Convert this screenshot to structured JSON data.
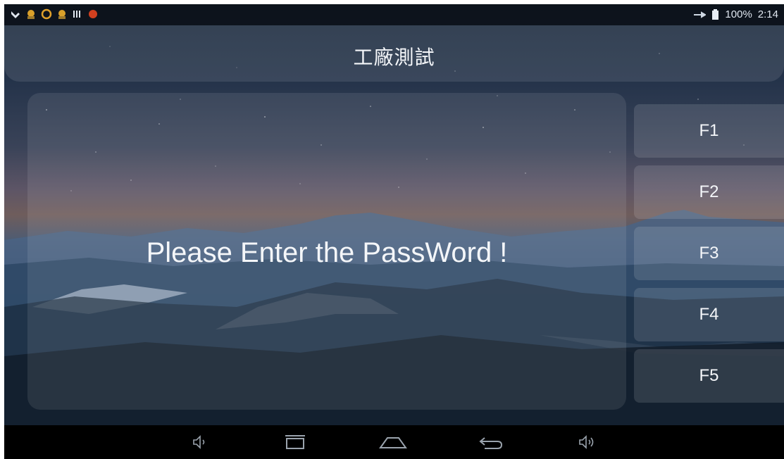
{
  "status_bar": {
    "left_icons": [
      "tool-icon",
      "android-icon",
      "sync-icon",
      "android-icon",
      "barcode-icon",
      "record-icon"
    ],
    "battery": "100%",
    "time": "2:14"
  },
  "header": {
    "title": "工廠測試"
  },
  "main": {
    "message": "Please Enter the PassWord !"
  },
  "function_buttons": [
    "F1",
    "F2",
    "F3",
    "F4",
    "F5"
  ],
  "nav_bar": {
    "icons": [
      "volume-down-icon",
      "recent-apps-icon",
      "home-icon",
      "back-icon",
      "volume-up-icon"
    ]
  },
  "colors": {
    "accent_text": "#f4f6f9",
    "nav_background": "#000000"
  }
}
